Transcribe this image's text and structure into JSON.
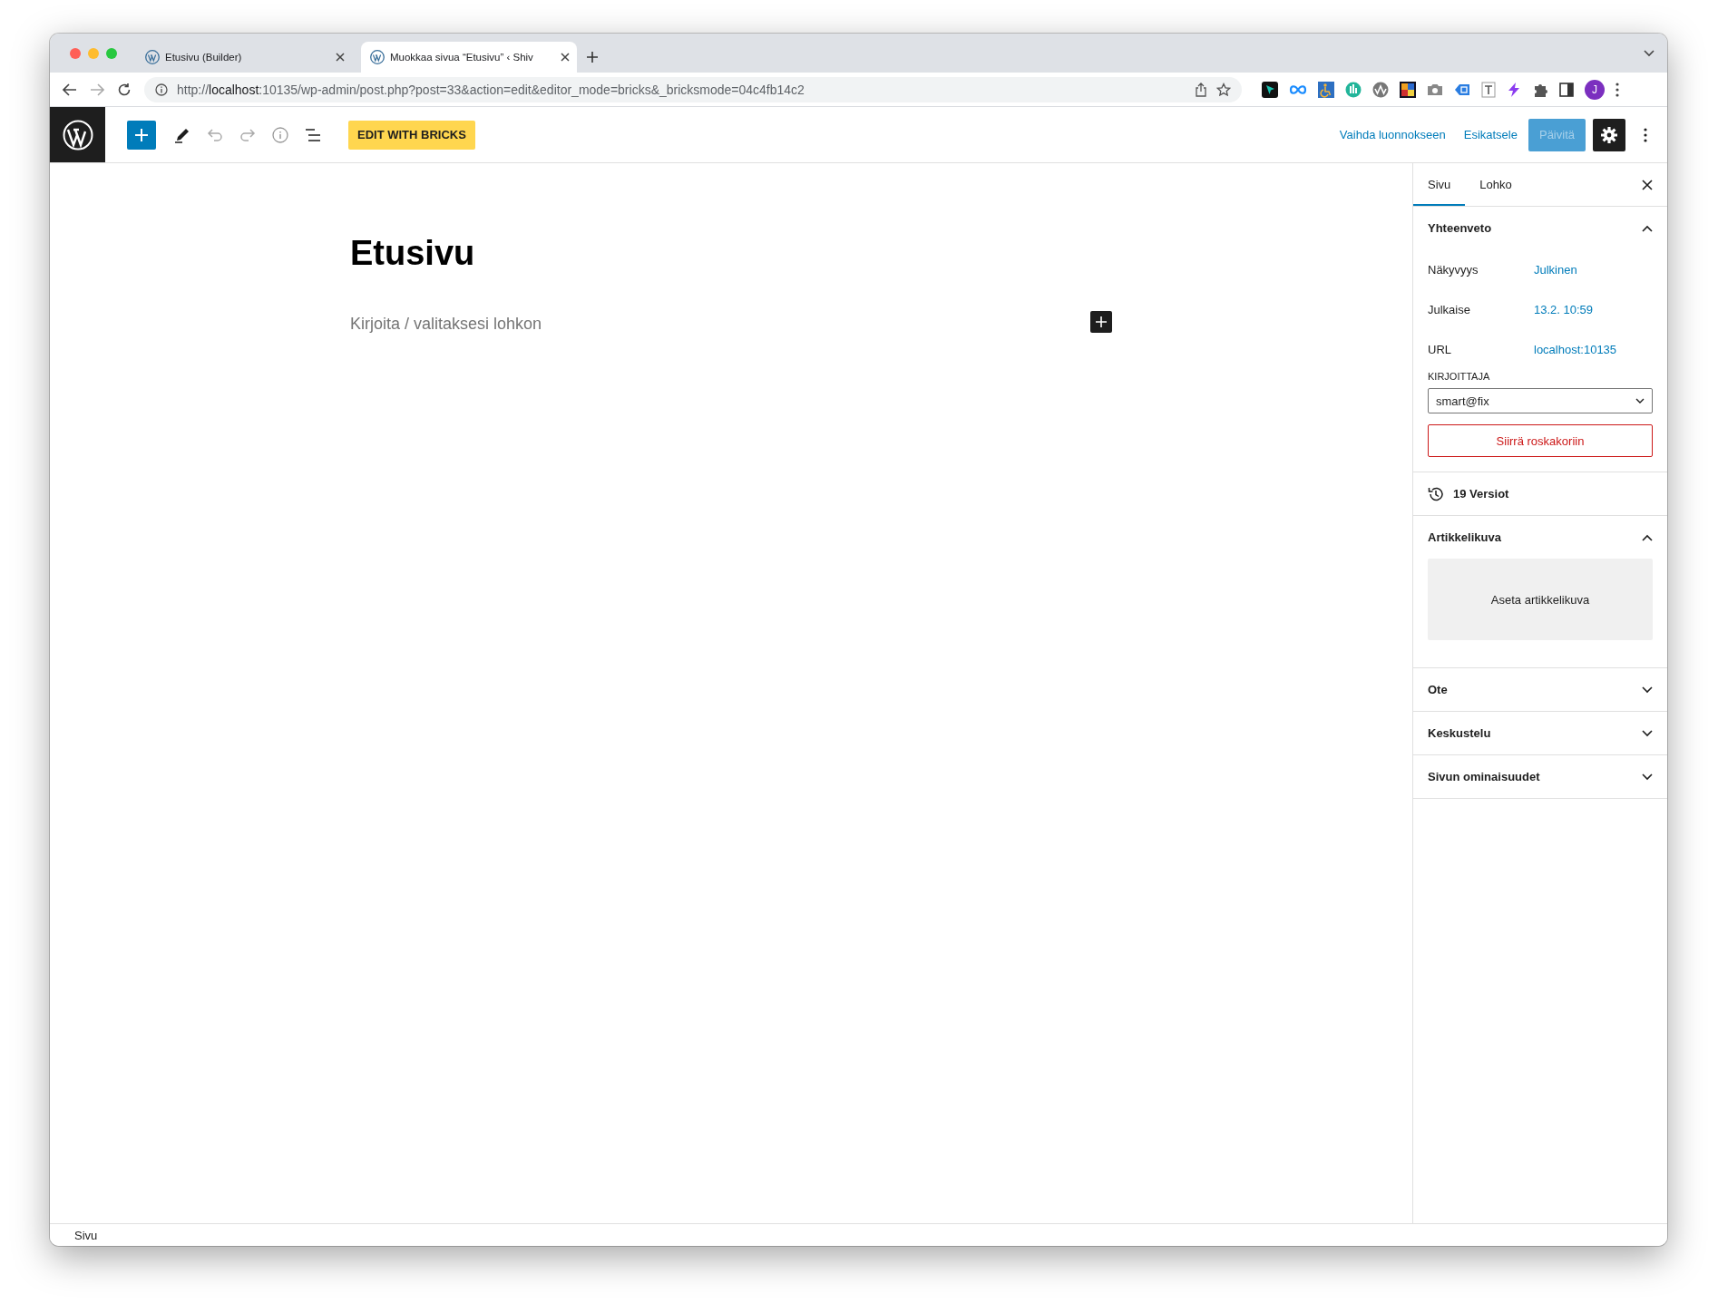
{
  "browser": {
    "tabs": [
      {
        "title": "Etusivu (Builder)",
        "selected": false
      },
      {
        "title": "Muokkaa sivua “Etusivu” ‹ Shiv",
        "selected": true
      }
    ],
    "url": "http://**localhost**:10135/wp-admin/post.php?post=33&action=edit&editor_mode=bricks&_bricksmode=04c4fb14c2",
    "profile_initial": "J"
  },
  "toolbar": {
    "bricks_button": "EDIT WITH BRICKS",
    "switch_to_draft": "Vaihda luonnokseen",
    "preview": "Esikatsele",
    "update": {
      "label": "Päivitä",
      "disabled": true
    },
    "settings": {
      "on": true
    }
  },
  "editor": {
    "title": "Etusivu",
    "placeholder": "Kirjoita / valitaksesi lohkon"
  },
  "sidebar": {
    "tabs": [
      {
        "label": "Sivu",
        "selected": true
      },
      {
        "label": "Lohko",
        "selected": false
      }
    ],
    "panels": [
      {
        "kind": "summary",
        "title": "Yhteenveto",
        "expanded": true,
        "rows": [
          {
            "label": "Näkyvyys",
            "value": "Julkinen"
          },
          {
            "label": "Julkaise",
            "value": "13.2. 10:59"
          },
          {
            "label": "URL",
            "value": "localhost:10135"
          }
        ],
        "author_label": "KIRJOITTAJA",
        "author": "smart@fix",
        "trash_button": "Siirrä roskakoriin"
      },
      {
        "kind": "revisions",
        "title": "19 Versiot"
      },
      {
        "kind": "featured-image",
        "title": "Artikkelikuva",
        "expanded": true,
        "button": "Aseta artikkelikuva"
      },
      {
        "kind": "section",
        "title": "Ote",
        "expanded": false
      },
      {
        "kind": "section",
        "title": "Keskustelu",
        "expanded": false
      },
      {
        "kind": "section",
        "title": "Sivun ominaisuudet",
        "expanded": false
      }
    ]
  },
  "footer": {
    "breadcrumb": "Sivu"
  }
}
